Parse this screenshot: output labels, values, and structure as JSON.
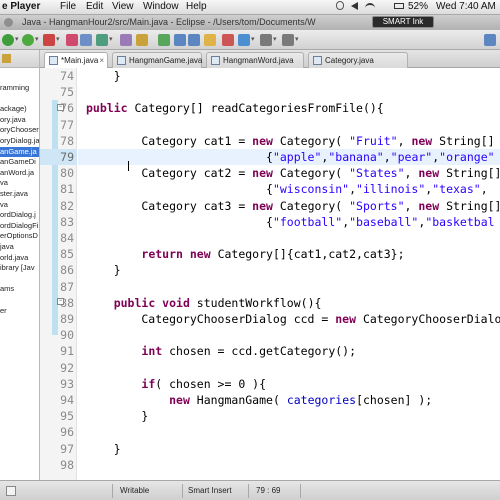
{
  "menubar": {
    "app_name": "e Player",
    "menus": [
      "File",
      "Edit",
      "View",
      "Window",
      "Help"
    ],
    "battery": "52%",
    "clock": "Wed 7:40 AM"
  },
  "window": {
    "title": "Java - HangmanHour2/src/Main.java - Eclipse - /Users/tom/Documents/W",
    "smart_ink": "SMART Ink"
  },
  "explorer": {
    "items": [
      "ramming",
      "",
      "ackage)",
      "ory.java",
      "oryChooser",
      "oryDialog.ja",
      "anGame.ja",
      "anGameDi",
      "anWord.ja",
      "va",
      "ster.java",
      "va",
      "ordDialog.j",
      "ordDialogFi",
      "erOptionsD",
      "java",
      "orld.java",
      "ibrary [Jav",
      "",
      "ams",
      "",
      "er"
    ],
    "selected_index": 6
  },
  "tabs": [
    {
      "label": "*Main.java",
      "active": true
    },
    {
      "label": "HangmanGame.java",
      "active": false
    },
    {
      "label": "HangmanWord.java",
      "active": false
    },
    {
      "label": "Category.java",
      "active": false
    }
  ],
  "editor": {
    "current_line": "79",
    "lines": [
      {
        "n": "74",
        "code": [
          [
            "",
            "    }"
          ]
        ]
      },
      {
        "n": "75",
        "code": []
      },
      {
        "n": "76",
        "code": [
          [
            "kw",
            "public "
          ],
          [
            "",
            "Category[] readCategoriesFromFile(){"
          ]
        ]
      },
      {
        "n": "77",
        "code": []
      },
      {
        "n": "78",
        "code": [
          [
            "",
            "        Category cat1 = "
          ],
          [
            "kw",
            "new "
          ],
          [
            "",
            "Category( "
          ],
          [
            "str",
            "\"Fruit\""
          ],
          [
            "",
            ", "
          ],
          [
            "kw",
            "new "
          ],
          [
            "",
            "String[]"
          ]
        ]
      },
      {
        "n": "79",
        "code": [
          [
            "",
            "                          {"
          ],
          [
            "str",
            "\"apple\""
          ],
          [
            "",
            ","
          ],
          [
            "str",
            "\"banana\""
          ],
          [
            "",
            ","
          ],
          [
            "str",
            "\"pear\""
          ],
          [
            "",
            ","
          ],
          [
            "str",
            "\"orange\""
          ]
        ]
      },
      {
        "n": "80",
        "code": [
          [
            "",
            "        Category cat2 = "
          ],
          [
            "kw",
            "new "
          ],
          [
            "",
            "Category( "
          ],
          [
            "str",
            "\"States\""
          ],
          [
            "",
            ", "
          ],
          [
            "kw",
            "new "
          ],
          [
            "",
            "String[]"
          ]
        ]
      },
      {
        "n": "81",
        "code": [
          [
            "",
            "                          {"
          ],
          [
            "str",
            "\"wisconsin\""
          ],
          [
            "",
            ","
          ],
          [
            "str",
            "\"illinois\""
          ],
          [
            "",
            ","
          ],
          [
            "str",
            "\"texas\""
          ],
          [
            "",
            ","
          ]
        ]
      },
      {
        "n": "82",
        "code": [
          [
            "",
            "        Category cat3 = "
          ],
          [
            "kw",
            "new "
          ],
          [
            "",
            "Category( "
          ],
          [
            "str",
            "\"Sports\""
          ],
          [
            "",
            ", "
          ],
          [
            "kw",
            "new "
          ],
          [
            "",
            "String[]"
          ]
        ]
      },
      {
        "n": "83",
        "code": [
          [
            "",
            "                          {"
          ],
          [
            "str",
            "\"football\""
          ],
          [
            "",
            ","
          ],
          [
            "str",
            "\"baseball\""
          ],
          [
            "",
            ","
          ],
          [
            "str",
            "\"basketbal"
          ]
        ]
      },
      {
        "n": "84",
        "code": []
      },
      {
        "n": "85",
        "code": [
          [
            "",
            "        "
          ],
          [
            "kw",
            "return new "
          ],
          [
            "",
            "Category[]{cat1,cat2,cat3};"
          ]
        ]
      },
      {
        "n": "86",
        "code": [
          [
            "",
            "    }"
          ]
        ]
      },
      {
        "n": "87",
        "code": []
      },
      {
        "n": "88",
        "code": [
          [
            "",
            "    "
          ],
          [
            "kw",
            "public void "
          ],
          [
            "",
            "studentWorkflow(){"
          ]
        ]
      },
      {
        "n": "89",
        "code": [
          [
            "",
            "        CategoryChooserDialog ccd = "
          ],
          [
            "kw",
            "new "
          ],
          [
            "",
            "CategoryChooserDialog"
          ]
        ]
      },
      {
        "n": "90",
        "code": []
      },
      {
        "n": "91",
        "code": [
          [
            "",
            "        "
          ],
          [
            "kw",
            "int "
          ],
          [
            "",
            "chosen = ccd.getCategory();"
          ]
        ]
      },
      {
        "n": "92",
        "code": []
      },
      {
        "n": "93",
        "code": [
          [
            "",
            "        "
          ],
          [
            "kw",
            "if"
          ],
          [
            "",
            "( chosen >= 0 ){"
          ]
        ]
      },
      {
        "n": "94",
        "code": [
          [
            "",
            "            "
          ],
          [
            "kw",
            "new "
          ],
          [
            "",
            "HangmanGame( "
          ],
          [
            "fld",
            "categories"
          ],
          [
            "",
            "[chosen] );"
          ]
        ]
      },
      {
        "n": "95",
        "code": [
          [
            "",
            "        }"
          ]
        ]
      },
      {
        "n": "96",
        "code": []
      },
      {
        "n": "97",
        "code": [
          [
            "",
            "    }"
          ]
        ]
      },
      {
        "n": "98",
        "code": []
      }
    ]
  },
  "statusbar": {
    "writable": "Writable",
    "insert_mode": "Smart Insert",
    "position": "79 : 69"
  },
  "colors": {
    "keyword": "#7f0055",
    "string": "#2a00ff",
    "field": "#0000c0",
    "current_line": "#e8f2fe",
    "selection": "#3875d7"
  }
}
